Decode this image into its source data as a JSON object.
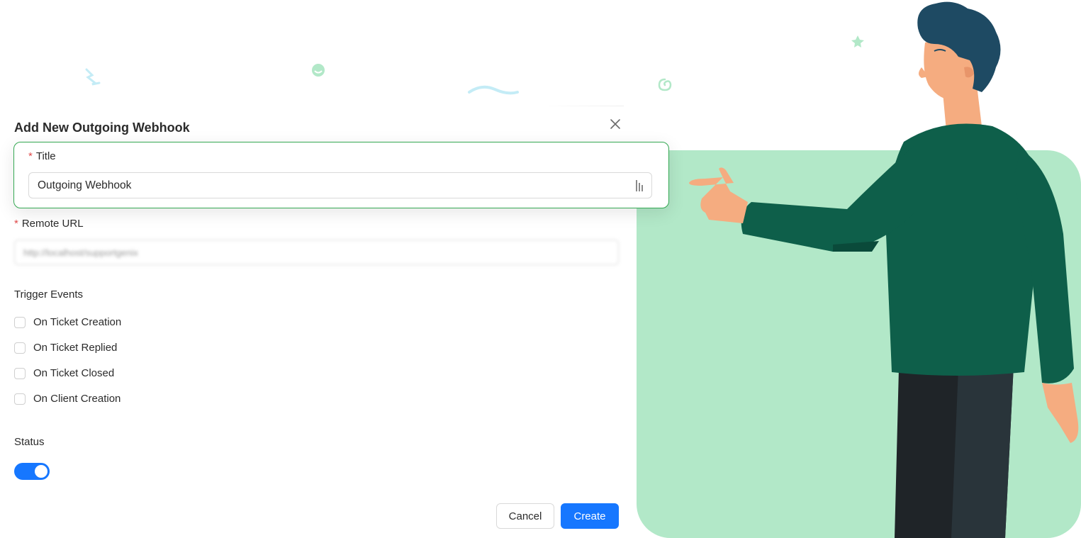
{
  "dialog": {
    "title": "Add New Outgoing Webhook",
    "close_icon": "close-icon"
  },
  "form": {
    "title_label": "Title",
    "title_value": "Outgoing Webhook",
    "remote_url_label": "Remote URL",
    "remote_url_value": "http://localhost/supportgenix",
    "trigger_events_label": "Trigger Events",
    "trigger_events": [
      {
        "label": "On Ticket Creation",
        "checked": false
      },
      {
        "label": "On Ticket Replied",
        "checked": false
      },
      {
        "label": "On Ticket Closed",
        "checked": false
      },
      {
        "label": "On Client Creation",
        "checked": false
      }
    ],
    "status_label": "Status",
    "status_enabled": true,
    "required_marker": "*"
  },
  "buttons": {
    "cancel": "Cancel",
    "create": "Create"
  },
  "colors": {
    "primary": "#1677ff",
    "highlight_border": "#35a853",
    "illustration_bg": "#b2e8c8",
    "required": "#e04b4b"
  }
}
